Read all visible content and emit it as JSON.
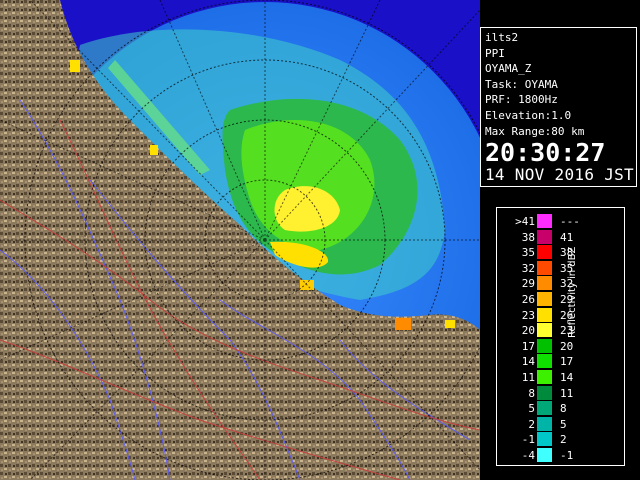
{
  "info": {
    "product": "ilts2",
    "mode": "PPI",
    "site": "OYAMA_Z",
    "task": "Task: OYAMA",
    "prf": "PRF: 1800Hz",
    "elevation": "Elevation:1.0",
    "max_range": "Max Range:80 km",
    "time": "20:30:27",
    "date": "14 NOV 2016 JST"
  },
  "legend": {
    "unit_label": "Reflectivity in dBZ",
    "rows": [
      {
        "lo": ">41",
        "hi": "---",
        "color": "#ff2cff"
      },
      {
        "lo": "38",
        "hi": "41",
        "color": "#c8006a"
      },
      {
        "lo": "35",
        "hi": "38",
        "color": "#ff0000"
      },
      {
        "lo": "32",
        "hi": "35",
        "color": "#ff4a00"
      },
      {
        "lo": "29",
        "hi": "32",
        "color": "#ff8c00"
      },
      {
        "lo": "26",
        "hi": "29",
        "color": "#ffb400"
      },
      {
        "lo": "23",
        "hi": "26",
        "color": "#ffe000"
      },
      {
        "lo": "20",
        "hi": "23",
        "color": "#ffff30"
      },
      {
        "lo": "17",
        "hi": "20",
        "color": "#00c000"
      },
      {
        "lo": "14",
        "hi": "17",
        "color": "#10e000"
      },
      {
        "lo": "11",
        "hi": "14",
        "color": "#3cf000"
      },
      {
        "lo": "8",
        "hi": "11",
        "color": "#008a3c"
      },
      {
        "lo": "5",
        "hi": "8",
        "color": "#00a878"
      },
      {
        "lo": "2",
        "hi": "5",
        "color": "#00b4a8"
      },
      {
        "lo": "-1",
        "hi": "2",
        "color": "#00c8c8"
      },
      {
        "lo": "-4",
        "hi": "-1",
        "color": "#40ffff"
      }
    ]
  },
  "colors": {
    "sea": "#1a10c8",
    "range_disc": "#1e7bef",
    "land": "#8c7a5e",
    "rivers": "#5a5aff",
    "roads": "#c83c3c"
  }
}
